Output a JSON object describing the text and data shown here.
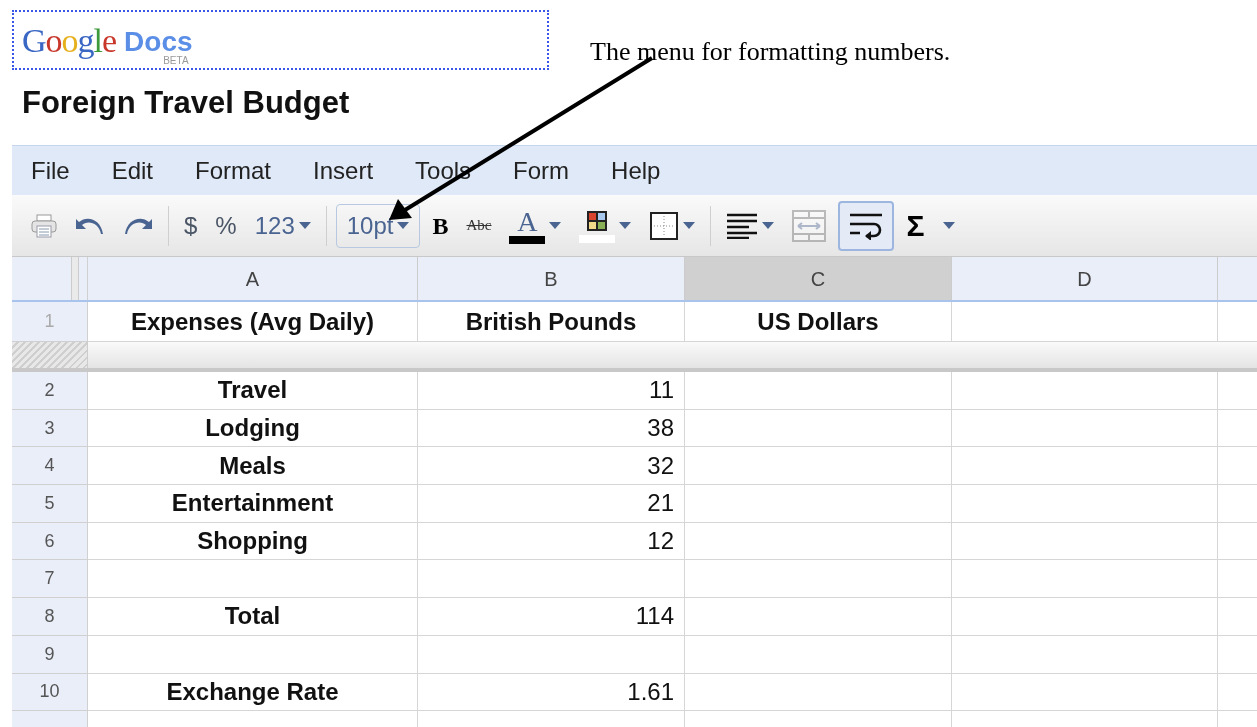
{
  "logo": {
    "brand": "Google",
    "product": "Docs",
    "badge": "BETA"
  },
  "annotation": "The menu for formatting numbers.",
  "title": "Foreign Travel Budget",
  "menu": [
    "File",
    "Edit",
    "Format",
    "Insert",
    "Tools",
    "Form",
    "Help"
  ],
  "toolbar": [
    {
      "kind": "print"
    },
    {
      "kind": "undo"
    },
    {
      "kind": "redo"
    },
    {
      "kind": "separator"
    },
    {
      "kind": "text",
      "label": "$"
    },
    {
      "kind": "text",
      "label": "%"
    },
    {
      "kind": "dropdown",
      "label": "123"
    },
    {
      "kind": "separator"
    },
    {
      "kind": "boxed",
      "label": "10pt"
    },
    {
      "kind": "bold",
      "label": "B"
    },
    {
      "kind": "strike",
      "label": "Abc"
    },
    {
      "kind": "fontcolor",
      "label": "A"
    },
    {
      "kind": "fillcolor"
    },
    {
      "kind": "borders"
    },
    {
      "kind": "separator"
    },
    {
      "kind": "align"
    },
    {
      "kind": "merge",
      "disabled": true
    },
    {
      "kind": "wrap",
      "pressed": true
    },
    {
      "kind": "sigma",
      "label": "Σ"
    }
  ],
  "sheet": {
    "columns": [
      {
        "label": "A",
        "selected": false
      },
      {
        "label": "B",
        "selected": false
      },
      {
        "label": "C",
        "selected": true
      },
      {
        "label": "D",
        "selected": false
      }
    ],
    "rows": [
      {
        "number": "1",
        "kind": "header",
        "cells": [
          "Expenses (Avg Daily)",
          "British Pounds",
          "US Dollars"
        ]
      },
      {
        "kind": "frozen"
      },
      {
        "number": "2",
        "cells": [
          "Travel",
          "11"
        ]
      },
      {
        "number": "3",
        "cells": [
          "Lodging",
          "38"
        ]
      },
      {
        "number": "4",
        "cells": [
          "Meals",
          "32"
        ]
      },
      {
        "number": "5",
        "cells": [
          "Entertainment",
          "21"
        ]
      },
      {
        "number": "6",
        "cells": [
          "Shopping",
          "12"
        ]
      },
      {
        "number": "7"
      },
      {
        "number": "8",
        "cells": [
          "Total",
          "114"
        ]
      },
      {
        "number": "9"
      },
      {
        "number": "10",
        "cells": [
          "Exchange Rate",
          "1.61"
        ]
      },
      {
        "kind": "cut"
      }
    ]
  }
}
